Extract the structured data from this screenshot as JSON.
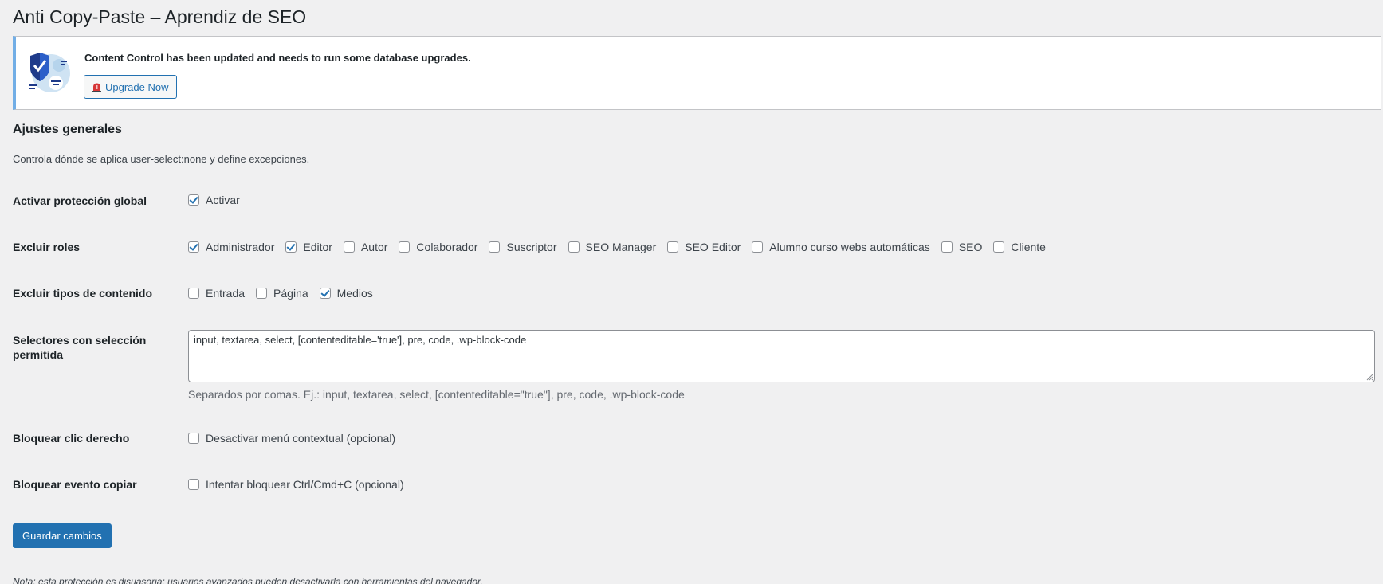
{
  "page": {
    "title": "Anti Copy-Paste – Aprendiz de SEO"
  },
  "notice": {
    "message": "Content Control has been updated and needs to run some database upgrades.",
    "button_label": "Upgrade Now",
    "button_icon": "siren-icon"
  },
  "section": {
    "title": "Ajustes generales",
    "description": "Controla dónde se aplica user-select:none y define excepciones."
  },
  "global_protection": {
    "label": "Activar protección global",
    "option": {
      "label": "Activar",
      "checked": true
    }
  },
  "exclude_roles": {
    "label": "Excluir roles",
    "options": [
      {
        "label": "Administrador",
        "checked": true
      },
      {
        "label": "Editor",
        "checked": true
      },
      {
        "label": "Autor",
        "checked": false
      },
      {
        "label": "Colaborador",
        "checked": false
      },
      {
        "label": "Suscriptor",
        "checked": false
      },
      {
        "label": "SEO Manager",
        "checked": false
      },
      {
        "label": "SEO Editor",
        "checked": false
      },
      {
        "label": "Alumno curso webs automáticas",
        "checked": false
      },
      {
        "label": "SEO",
        "checked": false
      },
      {
        "label": "Cliente",
        "checked": false
      }
    ]
  },
  "exclude_content_types": {
    "label": "Excluir tipos de contenido",
    "options": [
      {
        "label": "Entrada",
        "checked": false
      },
      {
        "label": "Página",
        "checked": false
      },
      {
        "label": "Medios",
        "checked": true
      }
    ]
  },
  "allowed_selectors": {
    "label": "Selectores con selección permitida",
    "value": "input, textarea, select, [contenteditable='true'], pre, code, .wp-block-code",
    "hint": "Separados por comas. Ej.: input, textarea, select, [contenteditable=\"true\"], pre, code, .wp-block-code"
  },
  "block_right_click": {
    "label": "Bloquear clic derecho",
    "option": {
      "label": "Desactivar menú contextual (opcional)",
      "checked": false
    }
  },
  "block_copy": {
    "label": "Bloquear evento copiar",
    "option": {
      "label": "Intentar bloquear Ctrl/Cmd+C (opcional)",
      "checked": false
    }
  },
  "save_label": "Guardar cambios",
  "footer_note": "Nota: esta protección es disuasoria; usuarios avanzados pueden desactivarla con herramientas del navegador.",
  "colors": {
    "accent": "#2271b1",
    "notice_border": "#72aee6",
    "background": "#f0f0f1"
  }
}
